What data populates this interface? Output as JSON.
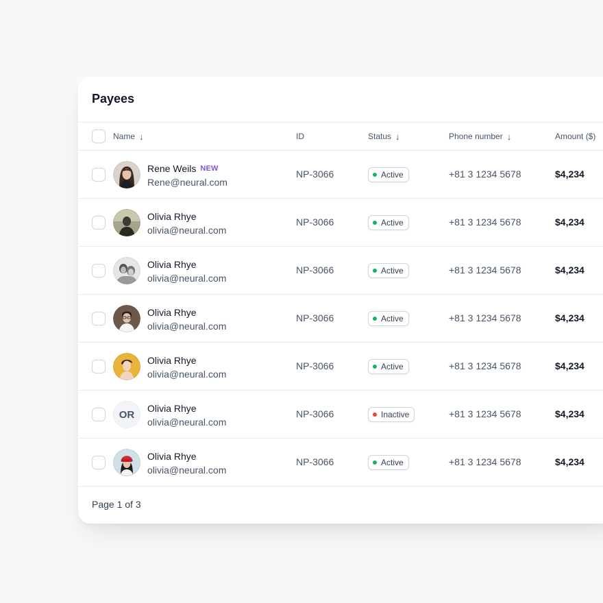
{
  "card": {
    "title": "Payees",
    "footer": "Page 1 of 3"
  },
  "table": {
    "headers": {
      "name": "Name",
      "id": "ID",
      "status": "Status",
      "phone": "Phone number",
      "amount": "Amount ($)"
    },
    "sortable": [
      "name",
      "status",
      "phone"
    ],
    "rows": [
      {
        "name": "Rene Weils",
        "tag": "NEW",
        "email": "Rene@neural.com",
        "id": "NP-3066",
        "status": "Active",
        "phone": "+81 3 1234 5678",
        "amount": "$4,234",
        "avatar": "photo-woman-long-brown-hair"
      },
      {
        "name": "Olivia Rhye",
        "tag": "",
        "email": "olivia@neural.com",
        "id": "NP-3066",
        "status": "Active",
        "phone": "+81 3 1234 5678",
        "amount": "$4,234",
        "avatar": "photo-dark-green-tone"
      },
      {
        "name": "Olivia Rhye",
        "tag": "",
        "email": "olivia@neural.com",
        "id": "NP-3066",
        "status": "Active",
        "phone": "+81 3 1234 5678",
        "amount": "$4,234",
        "avatar": "photo-grayscale-pair"
      },
      {
        "name": "Olivia Rhye",
        "tag": "",
        "email": "olivia@neural.com",
        "id": "NP-3066",
        "status": "Active",
        "phone": "+81 3 1234 5678",
        "amount": "$4,234",
        "avatar": "photo-man-white-shirt"
      },
      {
        "name": "Olivia Rhye",
        "tag": "",
        "email": "olivia@neural.com",
        "id": "NP-3066",
        "status": "Active",
        "phone": "+81 3 1234 5678",
        "amount": "$4,234",
        "avatar": "photo-yellow-background"
      },
      {
        "name": "Olivia Rhye",
        "tag": "",
        "email": "olivia@neural.com",
        "id": "NP-3066",
        "status": "Inactive",
        "phone": "+81 3 1234 5678",
        "amount": "$4,234",
        "avatar": "initials",
        "initials": "OR"
      },
      {
        "name": "Olivia Rhye",
        "tag": "",
        "email": "olivia@neural.com",
        "id": "NP-3066",
        "status": "Active",
        "phone": "+81 3 1234 5678",
        "amount": "$4,234",
        "avatar": "photo-red-beanie"
      }
    ]
  },
  "colors": {
    "active_dot": "#17b26a",
    "inactive_dot": "#f04438",
    "new_tag": "#7f56d9",
    "page_background": "#f8f8fa"
  },
  "icons": {
    "sort": "arrow-down-icon"
  }
}
